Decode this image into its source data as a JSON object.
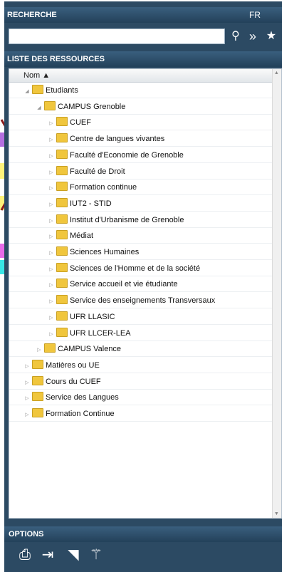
{
  "search": {
    "title": "RECHERCHE",
    "lang": "FR",
    "value": "",
    "placeholder": ""
  },
  "resources": {
    "title": "LISTE DES RESSOURCES",
    "column": "Nom ▲",
    "items": [
      {
        "label": "Etudiants",
        "level": 0,
        "expanded": true
      },
      {
        "label": "CAMPUS Grenoble",
        "level": 1,
        "expanded": true
      },
      {
        "label": "CUEF",
        "level": 2,
        "expanded": false
      },
      {
        "label": "Centre de langues vivantes",
        "level": 2,
        "expanded": false
      },
      {
        "label": "Faculté d'Economie de Grenoble",
        "level": 2,
        "expanded": false
      },
      {
        "label": "Faculté de Droit",
        "level": 2,
        "expanded": false
      },
      {
        "label": "Formation continue",
        "level": 2,
        "expanded": false
      },
      {
        "label": "IUT2 - STID",
        "level": 2,
        "expanded": false
      },
      {
        "label": "Institut d'Urbanisme de Grenoble",
        "level": 2,
        "expanded": false
      },
      {
        "label": "Médiat",
        "level": 2,
        "expanded": false
      },
      {
        "label": "Sciences Humaines",
        "level": 2,
        "expanded": false
      },
      {
        "label": "Sciences de l'Homme et de la société",
        "level": 2,
        "expanded": false
      },
      {
        "label": "Service accueil et vie étudiante",
        "level": 2,
        "expanded": false
      },
      {
        "label": "Service des enseignements Transversaux",
        "level": 2,
        "expanded": false
      },
      {
        "label": "UFR LLASIC",
        "level": 2,
        "expanded": false
      },
      {
        "label": "UFR LLCER-LEA",
        "level": 2,
        "expanded": false
      },
      {
        "label": "CAMPUS Valence",
        "level": 1,
        "expanded": false
      },
      {
        "label": "Matières ou UE",
        "level": 0,
        "expanded": false
      },
      {
        "label": "Cours du CUEF",
        "level": 0,
        "expanded": false
      },
      {
        "label": "Service des Langues",
        "level": 0,
        "expanded": false
      },
      {
        "label": "Formation Continue",
        "level": 0,
        "expanded": false
      }
    ]
  },
  "options": {
    "title": "OPTIONS"
  },
  "colors": {
    "panel": "#2c4a63",
    "folder": "#f0c63d",
    "purple": "#b46ee0",
    "yellow": "#fff27a",
    "magenta": "#e76ae8",
    "cyan": "#38e6e6",
    "arrow": "#8a1c1c"
  }
}
